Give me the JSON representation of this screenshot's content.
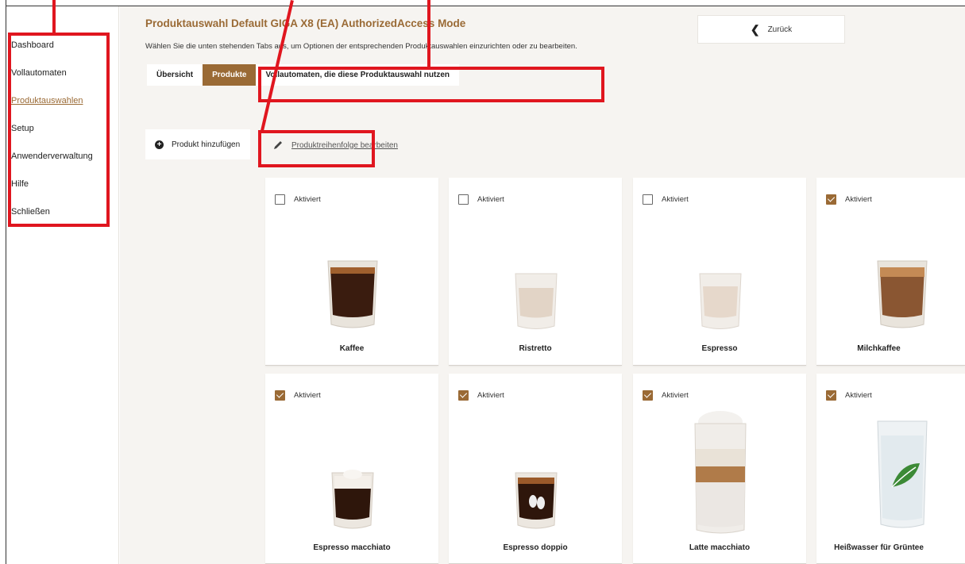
{
  "sidebar": {
    "items": [
      {
        "label": "Dashboard"
      },
      {
        "label": "Vollautomaten"
      },
      {
        "label": "Produktauswahlen"
      },
      {
        "label": "Setup"
      },
      {
        "label": "Anwenderverwaltung"
      },
      {
        "label": "Hilfe"
      },
      {
        "label": "Schließen"
      }
    ]
  },
  "header": {
    "title": "Produktauswahl Default GIGA X8 (EA) AuthorizedAccess Mode",
    "subtitle": "Wählen Sie die unten stehenden Tabs aus, um Optionen der entsprechenden Produktauswahlen einzurichten oder zu bearbeiten.",
    "back_label": "Zurück"
  },
  "tabs": [
    {
      "label": "Übersicht"
    },
    {
      "label": "Produkte"
    },
    {
      "label": "Vollautomaten, die diese Produktauswahl nutzen"
    }
  ],
  "actions": {
    "add_label": "Produkt hinzufügen",
    "edit_order_label": "Produktreihenfolge bearbeiten"
  },
  "checkbox_label": "Aktiviert",
  "products": [
    {
      "name": "Kaffee",
      "active": true
    },
    {
      "name": "Ristretto",
      "active": false
    },
    {
      "name": "Espresso",
      "active": false
    },
    {
      "name": "Milchkaffee",
      "active": true
    },
    {
      "name": "Espresso macchiato",
      "active": true
    },
    {
      "name": "Espresso doppio",
      "active": true
    },
    {
      "name": "Latte macchiato",
      "active": true
    },
    {
      "name": "Heißwasser für Grüntee",
      "active": true
    }
  ],
  "colors": {
    "accent": "#9a6a35",
    "annotation": "#e0161f",
    "background": "#f6f4f1"
  }
}
